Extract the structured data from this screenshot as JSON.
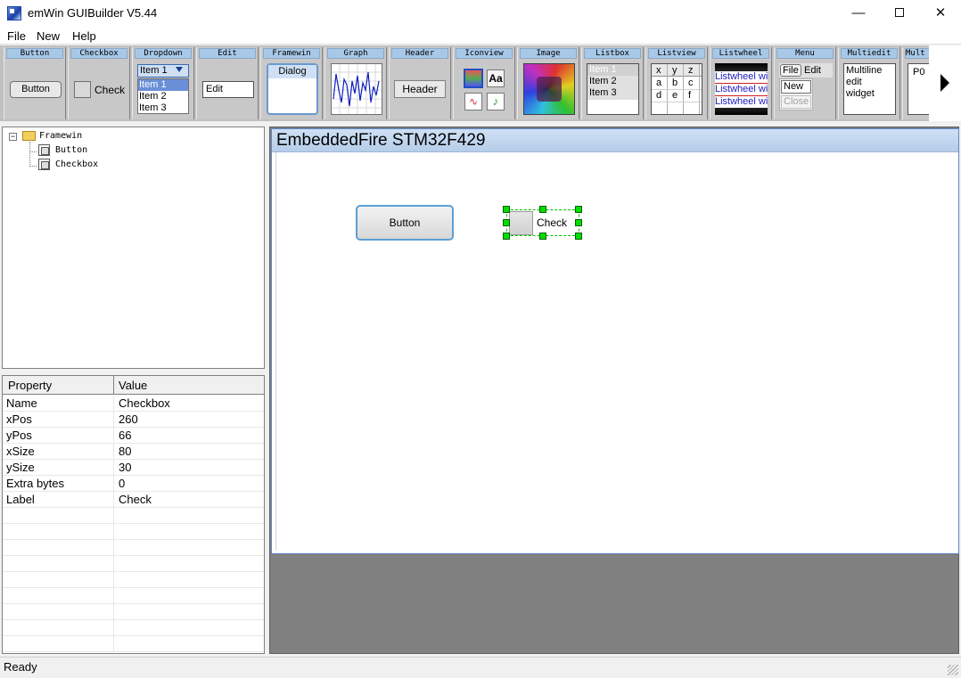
{
  "window": {
    "title": "emWin GUIBuilder V5.44",
    "minimize": "—",
    "close": "✕"
  },
  "menu": [
    "File",
    "New",
    "Help"
  ],
  "toolbox": {
    "button": {
      "caption": "Button",
      "sample": "Button"
    },
    "checkbox": {
      "caption": "Checkbox",
      "sample": "Check"
    },
    "dropdown": {
      "caption": "Dropdown",
      "selected": "Item 1",
      "items": [
        "Item 1",
        "Item 2",
        "Item 3"
      ]
    },
    "edit": {
      "caption": "Edit",
      "sample": "Edit"
    },
    "framewin": {
      "caption": "Framewin",
      "sample": "Dialog"
    },
    "graph": {
      "caption": "Graph"
    },
    "header": {
      "caption": "Header",
      "sample": "Header"
    },
    "iconview": {
      "caption": "Iconview",
      "aa": "Aa"
    },
    "image": {
      "caption": "Image"
    },
    "listbox": {
      "caption": "Listbox",
      "items": [
        "Item 1",
        "Item 2",
        "Item 3"
      ]
    },
    "listview": {
      "caption": "Listview",
      "cells": [
        [
          "x",
          "y",
          "z"
        ],
        [
          "a",
          "b",
          "c"
        ],
        [
          "d",
          "e",
          "f"
        ]
      ]
    },
    "listwheel": {
      "caption": "Listwheel",
      "items": [
        "Listwheel wi",
        "Listwheel wi",
        "Listwheel wi"
      ]
    },
    "menu": {
      "caption": "Menu",
      "items": [
        "File",
        "Edit",
        "New",
        "Close"
      ]
    },
    "multiedit": {
      "caption": "Multiedit",
      "lines": [
        "Multiline",
        "edit",
        "widget"
      ]
    },
    "mult2": {
      "caption": "Mult",
      "sample": "P0"
    }
  },
  "tree": {
    "root": "Framewin",
    "children": [
      "Button",
      "Checkbox"
    ]
  },
  "properties": {
    "header_property": "Property",
    "header_value": "Value",
    "rows": [
      {
        "key": "Name",
        "value": "Checkbox"
      },
      {
        "key": "xPos",
        "value": "260"
      },
      {
        "key": "yPos",
        "value": "66"
      },
      {
        "key": "xSize",
        "value": "80"
      },
      {
        "key": "ySize",
        "value": "30"
      },
      {
        "key": "Extra bytes",
        "value": "0"
      },
      {
        "key": "Label",
        "value": "Check"
      }
    ]
  },
  "canvas": {
    "frame_title": "EmbeddedFire STM32F429",
    "button_text": "Button",
    "checkbox_text": "Check"
  },
  "status": {
    "text": "Ready"
  }
}
